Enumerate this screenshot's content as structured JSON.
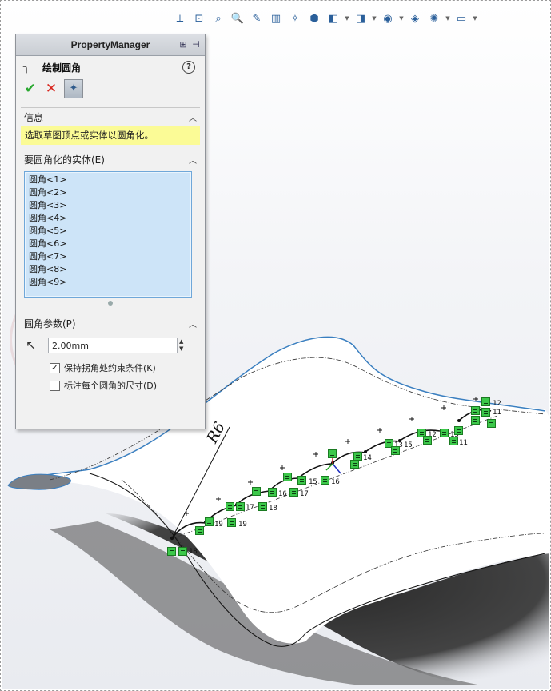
{
  "toolbar": {
    "icons": [
      "view-orientation-icon",
      "zoom-to-fit-icon",
      "zoom-to-area-icon",
      "zoom-icon",
      "previous-view-icon",
      "section-view-icon",
      "dynamic-annotation-icon",
      "view-cube-icon",
      "display-style-icon",
      "hide-show-icon",
      "edit-appearance-icon",
      "apply-scene-icon",
      "view-settings-icon",
      "monitor-icon"
    ]
  },
  "property_manager": {
    "header_title": "PropertyManager",
    "feature_title": "绘制圆角",
    "info": {
      "heading": "信息",
      "message": "选取草图顶点或实体以圆角化。"
    },
    "entities": {
      "heading": "要圆角化的实体(E)",
      "items": [
        "圆角<1>",
        "圆角<2>",
        "圆角<3>",
        "圆角<4>",
        "圆角<5>",
        "圆角<6>",
        "圆角<7>",
        "圆角<8>",
        "圆角<9>"
      ]
    },
    "params": {
      "heading": "圆角参数(P)",
      "radius_value": "2.00mm",
      "keep_constraints_label": "保持拐角处约束条件(K)",
      "keep_constraints_checked": true,
      "dimension_each_label": "标注每个圆角的尺寸(D)",
      "dimension_each_checked": false
    }
  },
  "model": {
    "dimension_label": "R6",
    "relation_labels": [
      "12",
      "12",
      "11",
      "11",
      "13",
      "15",
      "14",
      "16",
      "13",
      "16",
      "17",
      "16",
      "17",
      "18",
      "19",
      "18",
      "19"
    ]
  },
  "colors": {
    "relation_green": "#3cc84a",
    "info_yellow": "#fbfb96",
    "list_blue": "#cde4f8",
    "edge_blue": "#3a7fc0"
  }
}
